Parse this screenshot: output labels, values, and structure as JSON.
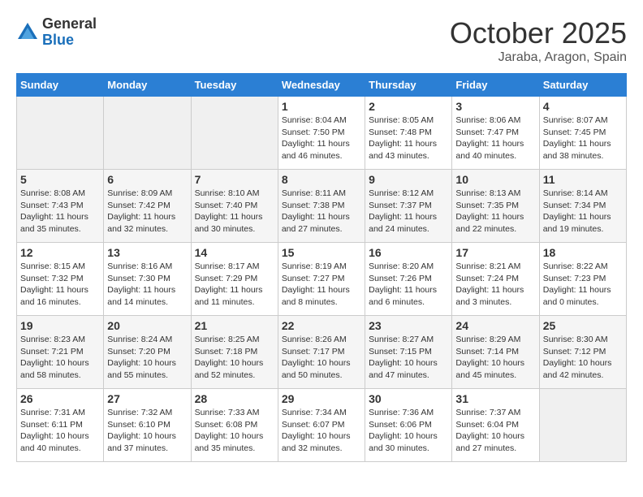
{
  "logo": {
    "general": "General",
    "blue": "Blue"
  },
  "title": "October 2025",
  "subtitle": "Jaraba, Aragon, Spain",
  "days_of_week": [
    "Sunday",
    "Monday",
    "Tuesday",
    "Wednesday",
    "Thursday",
    "Friday",
    "Saturday"
  ],
  "weeks": [
    [
      {
        "day": "",
        "info": ""
      },
      {
        "day": "",
        "info": ""
      },
      {
        "day": "",
        "info": ""
      },
      {
        "day": "1",
        "info": "Sunrise: 8:04 AM\nSunset: 7:50 PM\nDaylight: 11 hours and 46 minutes."
      },
      {
        "day": "2",
        "info": "Sunrise: 8:05 AM\nSunset: 7:48 PM\nDaylight: 11 hours and 43 minutes."
      },
      {
        "day": "3",
        "info": "Sunrise: 8:06 AM\nSunset: 7:47 PM\nDaylight: 11 hours and 40 minutes."
      },
      {
        "day": "4",
        "info": "Sunrise: 8:07 AM\nSunset: 7:45 PM\nDaylight: 11 hours and 38 minutes."
      }
    ],
    [
      {
        "day": "5",
        "info": "Sunrise: 8:08 AM\nSunset: 7:43 PM\nDaylight: 11 hours and 35 minutes."
      },
      {
        "day": "6",
        "info": "Sunrise: 8:09 AM\nSunset: 7:42 PM\nDaylight: 11 hours and 32 minutes."
      },
      {
        "day": "7",
        "info": "Sunrise: 8:10 AM\nSunset: 7:40 PM\nDaylight: 11 hours and 30 minutes."
      },
      {
        "day": "8",
        "info": "Sunrise: 8:11 AM\nSunset: 7:38 PM\nDaylight: 11 hours and 27 minutes."
      },
      {
        "day": "9",
        "info": "Sunrise: 8:12 AM\nSunset: 7:37 PM\nDaylight: 11 hours and 24 minutes."
      },
      {
        "day": "10",
        "info": "Sunrise: 8:13 AM\nSunset: 7:35 PM\nDaylight: 11 hours and 22 minutes."
      },
      {
        "day": "11",
        "info": "Sunrise: 8:14 AM\nSunset: 7:34 PM\nDaylight: 11 hours and 19 minutes."
      }
    ],
    [
      {
        "day": "12",
        "info": "Sunrise: 8:15 AM\nSunset: 7:32 PM\nDaylight: 11 hours and 16 minutes."
      },
      {
        "day": "13",
        "info": "Sunrise: 8:16 AM\nSunset: 7:30 PM\nDaylight: 11 hours and 14 minutes."
      },
      {
        "day": "14",
        "info": "Sunrise: 8:17 AM\nSunset: 7:29 PM\nDaylight: 11 hours and 11 minutes."
      },
      {
        "day": "15",
        "info": "Sunrise: 8:19 AM\nSunset: 7:27 PM\nDaylight: 11 hours and 8 minutes."
      },
      {
        "day": "16",
        "info": "Sunrise: 8:20 AM\nSunset: 7:26 PM\nDaylight: 11 hours and 6 minutes."
      },
      {
        "day": "17",
        "info": "Sunrise: 8:21 AM\nSunset: 7:24 PM\nDaylight: 11 hours and 3 minutes."
      },
      {
        "day": "18",
        "info": "Sunrise: 8:22 AM\nSunset: 7:23 PM\nDaylight: 11 hours and 0 minutes."
      }
    ],
    [
      {
        "day": "19",
        "info": "Sunrise: 8:23 AM\nSunset: 7:21 PM\nDaylight: 10 hours and 58 minutes."
      },
      {
        "day": "20",
        "info": "Sunrise: 8:24 AM\nSunset: 7:20 PM\nDaylight: 10 hours and 55 minutes."
      },
      {
        "day": "21",
        "info": "Sunrise: 8:25 AM\nSunset: 7:18 PM\nDaylight: 10 hours and 52 minutes."
      },
      {
        "day": "22",
        "info": "Sunrise: 8:26 AM\nSunset: 7:17 PM\nDaylight: 10 hours and 50 minutes."
      },
      {
        "day": "23",
        "info": "Sunrise: 8:27 AM\nSunset: 7:15 PM\nDaylight: 10 hours and 47 minutes."
      },
      {
        "day": "24",
        "info": "Sunrise: 8:29 AM\nSunset: 7:14 PM\nDaylight: 10 hours and 45 minutes."
      },
      {
        "day": "25",
        "info": "Sunrise: 8:30 AM\nSunset: 7:12 PM\nDaylight: 10 hours and 42 minutes."
      }
    ],
    [
      {
        "day": "26",
        "info": "Sunrise: 7:31 AM\nSunset: 6:11 PM\nDaylight: 10 hours and 40 minutes."
      },
      {
        "day": "27",
        "info": "Sunrise: 7:32 AM\nSunset: 6:10 PM\nDaylight: 10 hours and 37 minutes."
      },
      {
        "day": "28",
        "info": "Sunrise: 7:33 AM\nSunset: 6:08 PM\nDaylight: 10 hours and 35 minutes."
      },
      {
        "day": "29",
        "info": "Sunrise: 7:34 AM\nSunset: 6:07 PM\nDaylight: 10 hours and 32 minutes."
      },
      {
        "day": "30",
        "info": "Sunrise: 7:36 AM\nSunset: 6:06 PM\nDaylight: 10 hours and 30 minutes."
      },
      {
        "day": "31",
        "info": "Sunrise: 7:37 AM\nSunset: 6:04 PM\nDaylight: 10 hours and 27 minutes."
      },
      {
        "day": "",
        "info": ""
      }
    ]
  ]
}
